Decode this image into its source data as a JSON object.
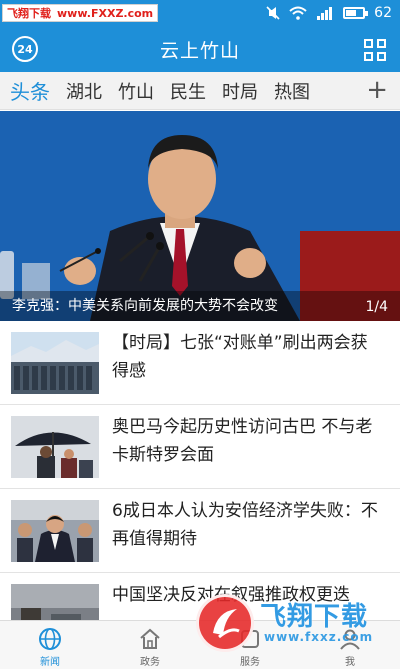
{
  "statusbar": {
    "watermark_site": "飞翔下载",
    "watermark_url": "www.FXXZ.com",
    "battery_level": "62",
    "battery_fraction": 0.62
  },
  "header": {
    "logo_text": "24",
    "title": "云上竹山"
  },
  "tabs": [
    "头条",
    "湖北",
    "竹山",
    "民生",
    "时局",
    "热图"
  ],
  "tab_add": "+",
  "hero": {
    "caption": "李克强：中美关系向前发展的大势不会改变",
    "page_current": "1",
    "page_total": "4"
  },
  "news": [
    {
      "title": "【时局】七张“对账单”刷出两会获得感"
    },
    {
      "title": "奥巴马今起历史性访问古巴 不与老卡斯特罗会面"
    },
    {
      "title": "6成日本人认为安倍经济学失败：不再值得期待"
    },
    {
      "title": "中国坚决反对在叙强推政权更迭"
    }
  ],
  "bottomnav": [
    {
      "label": "新闻",
      "icon": "globe-icon"
    },
    {
      "label": "政务",
      "icon": "home-icon"
    },
    {
      "label": "服务",
      "icon": "service-icon"
    },
    {
      "label": "我",
      "icon": "user-icon"
    }
  ],
  "watermark_bottom": {
    "brand": "飞翔下载",
    "url": "www.fxxz.com"
  },
  "colors": {
    "primary": "#1e8fd8",
    "watermark_red": "#e0201b"
  }
}
